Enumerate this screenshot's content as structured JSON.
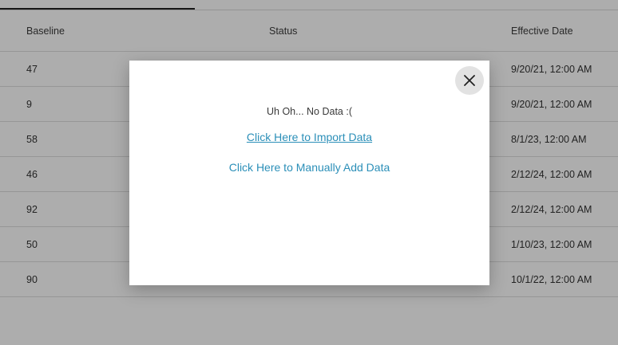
{
  "table": {
    "headers": {
      "baseline": "Baseline",
      "status": "Status",
      "effective_date": "Effective Date"
    },
    "rows": [
      {
        "baseline": "47",
        "status": "",
        "effective_date": "9/20/21, 12:00 AM"
      },
      {
        "baseline": "9",
        "status": "",
        "effective_date": "9/20/21, 12:00 AM"
      },
      {
        "baseline": "58",
        "status": "",
        "effective_date": "8/1/23, 12:00 AM"
      },
      {
        "baseline": "46",
        "status": "",
        "effective_date": "2/12/24, 12:00 AM"
      },
      {
        "baseline": "92",
        "status": "",
        "effective_date": "2/12/24, 12:00 AM"
      },
      {
        "baseline": "50",
        "status": "",
        "effective_date": "1/10/23, 12:00 AM"
      },
      {
        "baseline": "90",
        "status": "",
        "effective_date": "10/1/22, 12:00 AM"
      }
    ]
  },
  "modal": {
    "message": "Uh Oh... No Data :(",
    "import_link": "Click Here to Import Data",
    "manual_link": "Click Here to Manually Add Data",
    "close_icon": "close-icon"
  },
  "colors": {
    "link": "#2b8fb8",
    "overlay": "rgba(0,0,0,0.32)"
  }
}
